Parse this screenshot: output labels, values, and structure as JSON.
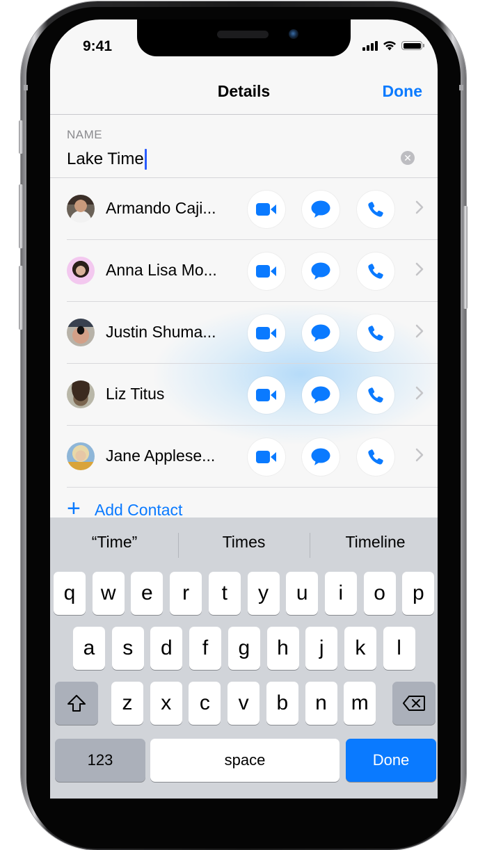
{
  "status_bar": {
    "time": "9:41",
    "icons": [
      "cellular-signal-icon",
      "wifi-icon",
      "battery-icon"
    ]
  },
  "nav": {
    "title": "Details",
    "done_label": "Done"
  },
  "name_field": {
    "label": "NAME",
    "value": "Lake Time",
    "clear_icon": "clear-circle-icon"
  },
  "contacts": [
    {
      "name": "Armando Caji...",
      "avatar": "photo-man-dark-hair"
    },
    {
      "name": "Anna Lisa Mo...",
      "avatar": "photo-woman-bangs"
    },
    {
      "name": "Justin Shuma...",
      "avatar": "photo-man-sunglasses-cap"
    },
    {
      "name": "Liz Titus",
      "avatar": "photo-dog-hat"
    },
    {
      "name": "Jane Applese...",
      "avatar": "photo-woman-blonde"
    }
  ],
  "contact_actions": [
    "video-call-icon",
    "message-icon",
    "phone-icon"
  ],
  "add_contact": {
    "label": "Add Contact",
    "icon": "plus-icon"
  },
  "colors": {
    "accent": "#0a7aff",
    "keyboard_bg": "#d1d4d9",
    "key_dark": "#abb0ba"
  },
  "keyboard": {
    "suggestions": [
      "“Time”",
      "Times",
      "Timeline"
    ],
    "row1": [
      "q",
      "w",
      "e",
      "r",
      "t",
      "y",
      "u",
      "i",
      "o",
      "p"
    ],
    "row2": [
      "a",
      "s",
      "d",
      "f",
      "g",
      "h",
      "j",
      "k",
      "l"
    ],
    "row3": [
      "z",
      "x",
      "c",
      "v",
      "b",
      "n",
      "m"
    ],
    "shift_icon": "shift-arrow-icon",
    "delete_icon": "backspace-icon",
    "numbers_label": "123",
    "space_label": "space",
    "return_label": "Done"
  }
}
